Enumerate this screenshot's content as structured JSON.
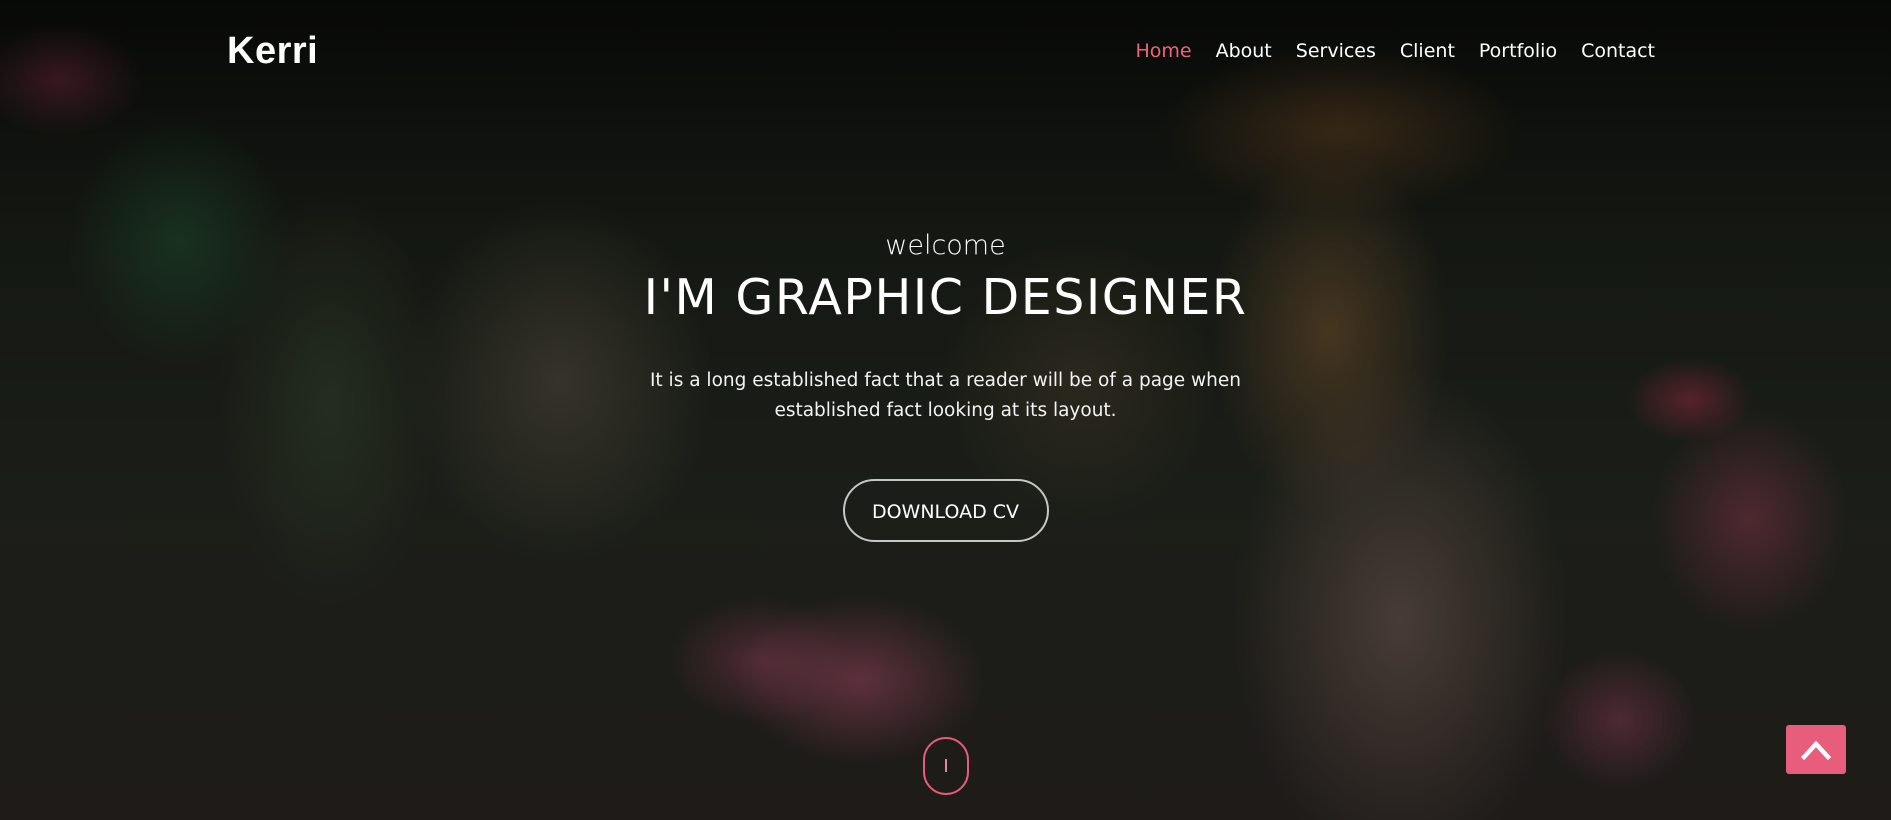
{
  "brand": {
    "logo": "Kerri"
  },
  "nav": {
    "items": [
      {
        "label": "Home",
        "active": true
      },
      {
        "label": "About"
      },
      {
        "label": "Services"
      },
      {
        "label": "Client"
      },
      {
        "label": "Portfolio"
      },
      {
        "label": "Contact"
      }
    ]
  },
  "hero": {
    "welcome": "welcome",
    "headline": "I'M GRAPHIC DESIGNER",
    "description": "It is a long established fact that a reader will be of a page when established fact looking at its layout.",
    "cta_label": "DOWNLOAD CV",
    "background_image": "woman-with-camera-in-flower-garden"
  },
  "colors": {
    "accent": "#e85c7c",
    "active_nav": "#f1627a",
    "text": "#ffffff"
  },
  "icons": {
    "scroll": "mouse-scroll-icon",
    "back_to_top": "chevron-up-icon"
  }
}
